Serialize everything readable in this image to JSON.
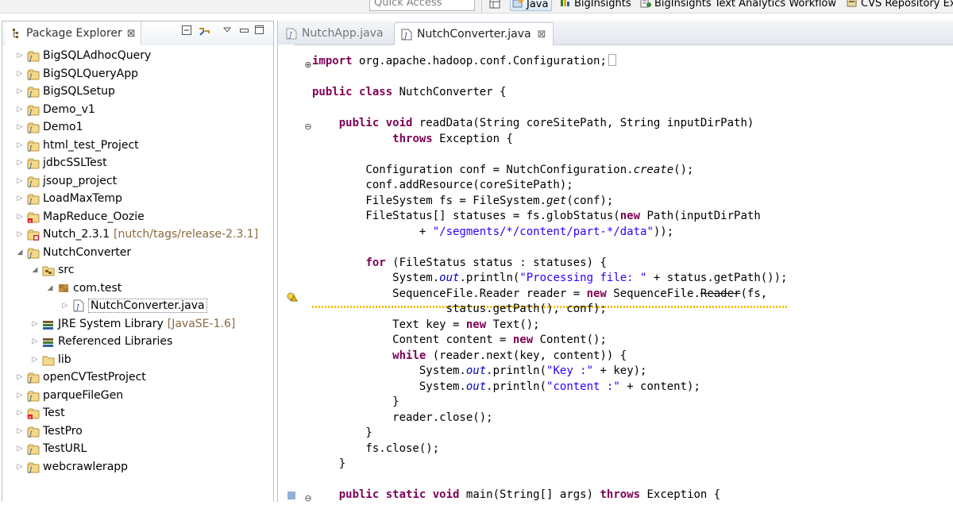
{
  "toolbar": {
    "quick_access_placeholder": "Quick Access",
    "perspectives": [
      {
        "label": "Java",
        "icon": "java-perspective-icon",
        "active": true
      },
      {
        "label": "BigInsights",
        "icon": "biginsights-icon",
        "active": false
      },
      {
        "label": "BigInsights Text Analytics Workflow",
        "icon": "text-analytics-icon",
        "active": false
      },
      {
        "label": "CVS Repository Ex",
        "icon": "cvs-icon",
        "active": false
      }
    ]
  },
  "explorer": {
    "title": "Package Explorer",
    "close_glyph": "⊠",
    "tree": [
      {
        "label": "BigSQLAdhocQuery",
        "icon": "project-icon",
        "expanded": false,
        "level": 0
      },
      {
        "label": "BigSQLQueryApp",
        "icon": "project-icon",
        "expanded": false,
        "level": 0
      },
      {
        "label": "BigSQLSetup",
        "icon": "project-icon",
        "expanded": false,
        "level": 0
      },
      {
        "label": "Demo_v1",
        "icon": "project-icon",
        "expanded": false,
        "level": 0
      },
      {
        "label": "Demo1",
        "icon": "project-icon",
        "expanded": false,
        "level": 0
      },
      {
        "label": "html_test_Project",
        "icon": "project-icon",
        "expanded": false,
        "level": 0
      },
      {
        "label": "jdbcSSLTest",
        "icon": "project-icon",
        "expanded": false,
        "level": 0
      },
      {
        "label": "jsoup_project",
        "icon": "project-icon",
        "expanded": false,
        "level": 0
      },
      {
        "label": "LoadMaxTemp",
        "icon": "project-icon",
        "expanded": false,
        "level": 0
      },
      {
        "label": "MapReduce_Oozie",
        "icon": "project-error-icon",
        "expanded": false,
        "level": 0
      },
      {
        "label": "Nutch_2.3.1",
        "decoration": "[nutch/tags/release-2.3.1]",
        "icon": "svn-project-icon",
        "expanded": false,
        "level": 0
      },
      {
        "label": "NutchConverter",
        "icon": "project-icon",
        "expanded": true,
        "level": 0
      },
      {
        "label": "src",
        "icon": "source-folder-icon",
        "expanded": true,
        "level": 1
      },
      {
        "label": "com.test",
        "icon": "package-icon",
        "expanded": true,
        "level": 2
      },
      {
        "label": "NutchConverter.java",
        "icon": "java-file-icon",
        "expanded": false,
        "level": 3,
        "selected": true
      },
      {
        "label": "JRE System Library",
        "decoration": "[JavaSE-1.6]",
        "icon": "library-icon",
        "expanded": false,
        "level": 1
      },
      {
        "label": "Referenced Libraries",
        "icon": "library-icon",
        "expanded": false,
        "level": 1
      },
      {
        "label": "lib",
        "icon": "folder-icon",
        "expanded": false,
        "level": 1
      },
      {
        "label": "openCVTestProject",
        "icon": "project-icon",
        "expanded": false,
        "level": 0
      },
      {
        "label": "parqueFileGen",
        "icon": "project-icon",
        "expanded": false,
        "level": 0
      },
      {
        "label": "Test",
        "icon": "project-error-icon",
        "expanded": false,
        "level": 0
      },
      {
        "label": "TestPro",
        "icon": "project-icon",
        "expanded": false,
        "level": 0
      },
      {
        "label": "TestURL",
        "icon": "project-icon",
        "expanded": false,
        "level": 0
      },
      {
        "label": "webcrawlerapp",
        "icon": "project-icon",
        "expanded": false,
        "level": 0
      }
    ]
  },
  "editor": {
    "tabs": [
      {
        "label": "NutchApp.java",
        "active": false
      },
      {
        "label": "NutchConverter.java",
        "active": true,
        "close_glyph": "⊠"
      }
    ],
    "code": [
      [
        [
          "kw",
          "import"
        ],
        [
          "t",
          " org.apache.hadoop.conf.Configuration;"
        ]
      ],
      [],
      [
        [
          "kw",
          "public"
        ],
        [
          "t",
          " "
        ],
        [
          "kw",
          "class"
        ],
        [
          "t",
          " NutchConverter {"
        ]
      ],
      [],
      [
        [
          "t",
          "    "
        ],
        [
          "kw",
          "public"
        ],
        [
          "t",
          " "
        ],
        [
          "kw",
          "void"
        ],
        [
          "t",
          " readData(String coreSitePath, String inputDirPath)"
        ]
      ],
      [
        [
          "t",
          "            "
        ],
        [
          "kw",
          "throws"
        ],
        [
          "t",
          " Exception {"
        ]
      ],
      [],
      [
        [
          "t",
          "        Configuration conf = NutchConfiguration."
        ],
        [
          "it",
          "create"
        ],
        [
          "t",
          "();"
        ]
      ],
      [
        [
          "t",
          "        conf.addResource(coreSitePath);"
        ]
      ],
      [
        [
          "t",
          "        FileSystem fs = FileSystem."
        ],
        [
          "it",
          "get"
        ],
        [
          "t",
          "(conf);"
        ]
      ],
      [
        [
          "t",
          "        FileStatus[] statuses = fs.globStatus("
        ],
        [
          "kw",
          "new"
        ],
        [
          "t",
          " Path(inputDirPath"
        ]
      ],
      [
        [
          "t",
          "                + "
        ],
        [
          "str",
          "\"/segments/*/content/part-*/data\""
        ],
        [
          "t",
          "));"
        ]
      ],
      [],
      [
        [
          "t",
          "        "
        ],
        [
          "kw",
          "for"
        ],
        [
          "t",
          " (FileStatus status : statuses) {"
        ]
      ],
      [
        [
          "t",
          "            System."
        ],
        [
          "fld",
          "out"
        ],
        [
          "t",
          ".println("
        ],
        [
          "str",
          "\"Processing file: \""
        ],
        [
          "t",
          " + status.getPath());"
        ]
      ],
      [
        [
          "t",
          "            SequenceFile.Reader reader = "
        ],
        [
          "kw",
          "new"
        ],
        [
          "t",
          " SequenceFile."
        ],
        [
          "strike",
          "Reader"
        ],
        [
          "t",
          "(fs,"
        ]
      ],
      [
        [
          "t",
          "                    status.getPath(), conf);"
        ]
      ],
      [
        [
          "t",
          "            Text key = "
        ],
        [
          "kw",
          "new"
        ],
        [
          "t",
          " Text();"
        ]
      ],
      [
        [
          "t",
          "            Content content = "
        ],
        [
          "kw",
          "new"
        ],
        [
          "t",
          " Content();"
        ]
      ],
      [
        [
          "t",
          "            "
        ],
        [
          "kw",
          "while"
        ],
        [
          "t",
          " (reader.next(key, content)) {"
        ]
      ],
      [
        [
          "t",
          "                System."
        ],
        [
          "fld",
          "out"
        ],
        [
          "t",
          ".println("
        ],
        [
          "str",
          "\"Key :\""
        ],
        [
          "t",
          " + key);"
        ]
      ],
      [
        [
          "t",
          "                System."
        ],
        [
          "fld",
          "out"
        ],
        [
          "t",
          ".println("
        ],
        [
          "str",
          "\"content :\""
        ],
        [
          "t",
          " + content);"
        ]
      ],
      [
        [
          "t",
          "            }"
        ]
      ],
      [
        [
          "t",
          "            reader.close();"
        ]
      ],
      [
        [
          "t",
          "        }"
        ]
      ],
      [
        [
          "t",
          "        fs.close();"
        ]
      ],
      [
        [
          "t",
          "    }"
        ]
      ],
      [],
      [
        [
          "t",
          "    "
        ],
        [
          "kw",
          "public"
        ],
        [
          "t",
          " "
        ],
        [
          "kw",
          "static"
        ],
        [
          "t",
          " "
        ],
        [
          "kw",
          "void"
        ],
        [
          "t",
          " main(String[] args) "
        ],
        [
          "kw",
          "throws"
        ],
        [
          "t",
          " Exception {"
        ]
      ]
    ]
  },
  "colors": {
    "keyword": "#7f0055",
    "string": "#2a00ff",
    "field": "#0000c0",
    "decoration": "#8a6a3d"
  }
}
